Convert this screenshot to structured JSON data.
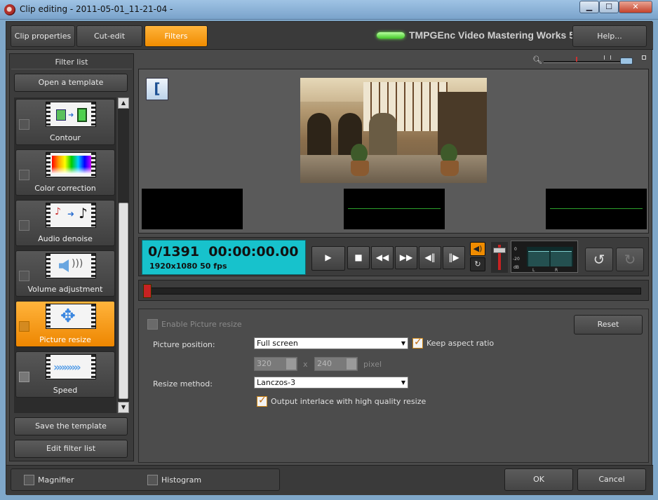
{
  "window": {
    "title": "Clip editing - 2011-05-01_11-21-04 -"
  },
  "tabs": [
    {
      "label": "Clip properties"
    },
    {
      "label": "Cut-edit"
    },
    {
      "label": "Filters"
    }
  ],
  "brand": "TMPGEnc Video Mastering Works 5",
  "help_label": "Help...",
  "filter_panel": {
    "header": "Filter list",
    "open_template": "Open a template",
    "save_template": "Save the template",
    "edit_filter_list": "Edit filter list",
    "items": [
      {
        "label": "Contour",
        "checked": false,
        "icon": "contour-icon"
      },
      {
        "label": "Color correction",
        "checked": false,
        "icon": "color-correction-icon"
      },
      {
        "label": "Audio denoise",
        "checked": false,
        "icon": "audio-denoise-icon"
      },
      {
        "label": "Volume adjustment",
        "checked": false,
        "icon": "volume-icon"
      },
      {
        "label": "Picture resize",
        "checked": true,
        "icon": "resize-arrows-icon"
      },
      {
        "label": "Speed",
        "checked": true,
        "icon": "speed-chevrons-icon"
      }
    ]
  },
  "transport": {
    "frame": "0/1391",
    "time": "00:00:00.00",
    "resolution": "1920x1080 50 fps"
  },
  "meter": {
    "scale": [
      "0",
      "-20",
      "dB"
    ],
    "channels": [
      "L",
      "R"
    ]
  },
  "settings": {
    "enable_label": "Enable Picture resize",
    "reset_label": "Reset",
    "position_label": "Picture position:",
    "position_value": "Full screen",
    "keep_aspect_label": "Keep aspect ratio",
    "width_value": "320",
    "x_label": "x",
    "height_value": "240",
    "pixel_label": "pixel",
    "resize_method_label": "Resize method:",
    "resize_method_value": "Lanczos-3",
    "interlace_label": "Output interlace with high quality resize"
  },
  "bottom": {
    "magnifier": "Magnifier",
    "histogram": "Histogram",
    "ok": "OK",
    "cancel": "Cancel"
  },
  "colors": {
    "accent": "#f39200",
    "timecode_bg": "#17c2cc",
    "led": "#5fe03f"
  }
}
